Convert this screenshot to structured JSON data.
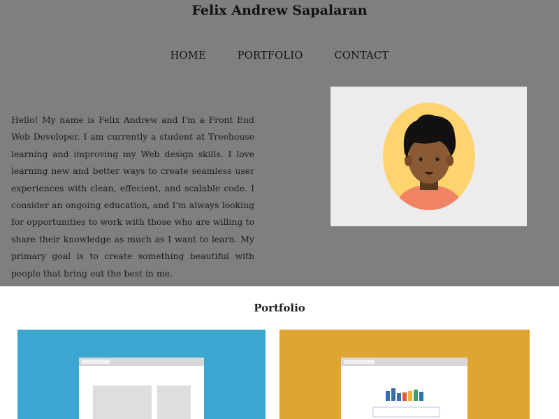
{
  "header": {
    "site_title": "Felix Andrew Sapalaran"
  },
  "nav": {
    "items": [
      {
        "label": "HOME"
      },
      {
        "label": "PORTFOLIO"
      },
      {
        "label": "CONTACT"
      }
    ]
  },
  "about": {
    "bio": "Hello! My name is Felix Andrew and I'm a Front End Web Developer. I am currently a student at Treehouse learning and improving my Web design skills. I love learning new and better ways to create seamless user experiences with clean, effecient, and scalable code. I consider an ongoing education, and I'm always looking for opportunities to work with those who are willing to share their knowledge as much as I want to learn. My primary goal is to create something beautiful with people that bring out the best in me.",
    "avatar_icon": "person-avatar-icon"
  },
  "portfolio": {
    "heading": "Portfolio",
    "items": [
      {
        "icon": "browser-window-icon",
        "color": "#3aa7d1"
      },
      {
        "icon": "browser-chart-icon",
        "color": "#dfa532"
      }
    ]
  },
  "colors": {
    "hero_background": "#7f7f7f",
    "avatar_background": "#ffd36e",
    "avatar_shirt": "#f08363"
  }
}
